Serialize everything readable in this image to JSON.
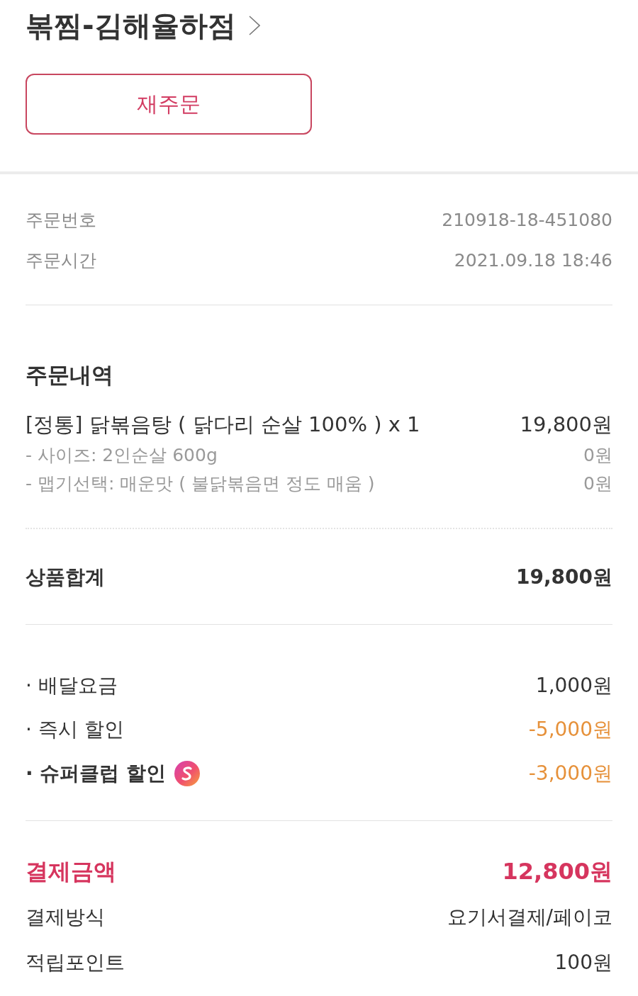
{
  "store": {
    "name": "볶찜-김해율하점"
  },
  "reorder_button": {
    "label": "재주문"
  },
  "order_info": [
    {
      "label": "주문번호",
      "value": "210918-18-451080"
    },
    {
      "label": "주문시간",
      "value": "2021.09.18 18:46"
    }
  ],
  "order_details": {
    "title": "주문내역",
    "items": [
      {
        "kind": "item",
        "name": "[정통] 닭볶음탕 ( 닭다리 순살 100% ) x 1",
        "price": "19,800원"
      },
      {
        "kind": "option",
        "name": "- 사이즈: 2인순살 600g",
        "price": "0원"
      },
      {
        "kind": "option",
        "name": "- 맵기선택: 매운맛 ( 불닭볶음면 정도 매움 )",
        "price": "0원"
      }
    ]
  },
  "subtotal": {
    "label": "상품합계",
    "value": "19,800원"
  },
  "charges": [
    {
      "kind": "fee",
      "label": "· 배달요금",
      "value": "1,000원"
    },
    {
      "kind": "discount",
      "label": "· 즉시 할인",
      "value": "-5,000원"
    },
    {
      "kind": "club_discount",
      "label": "· 슈퍼클럽 할인",
      "value": "-3,000원"
    }
  ],
  "payment": [
    {
      "kind": "total",
      "label": "결제금액",
      "value": "12,800원"
    },
    {
      "kind": "normal",
      "label": "결제방식",
      "value": "요기서결제/페이코"
    },
    {
      "kind": "normal",
      "label": "적립포인트",
      "value": "100원"
    }
  ]
}
